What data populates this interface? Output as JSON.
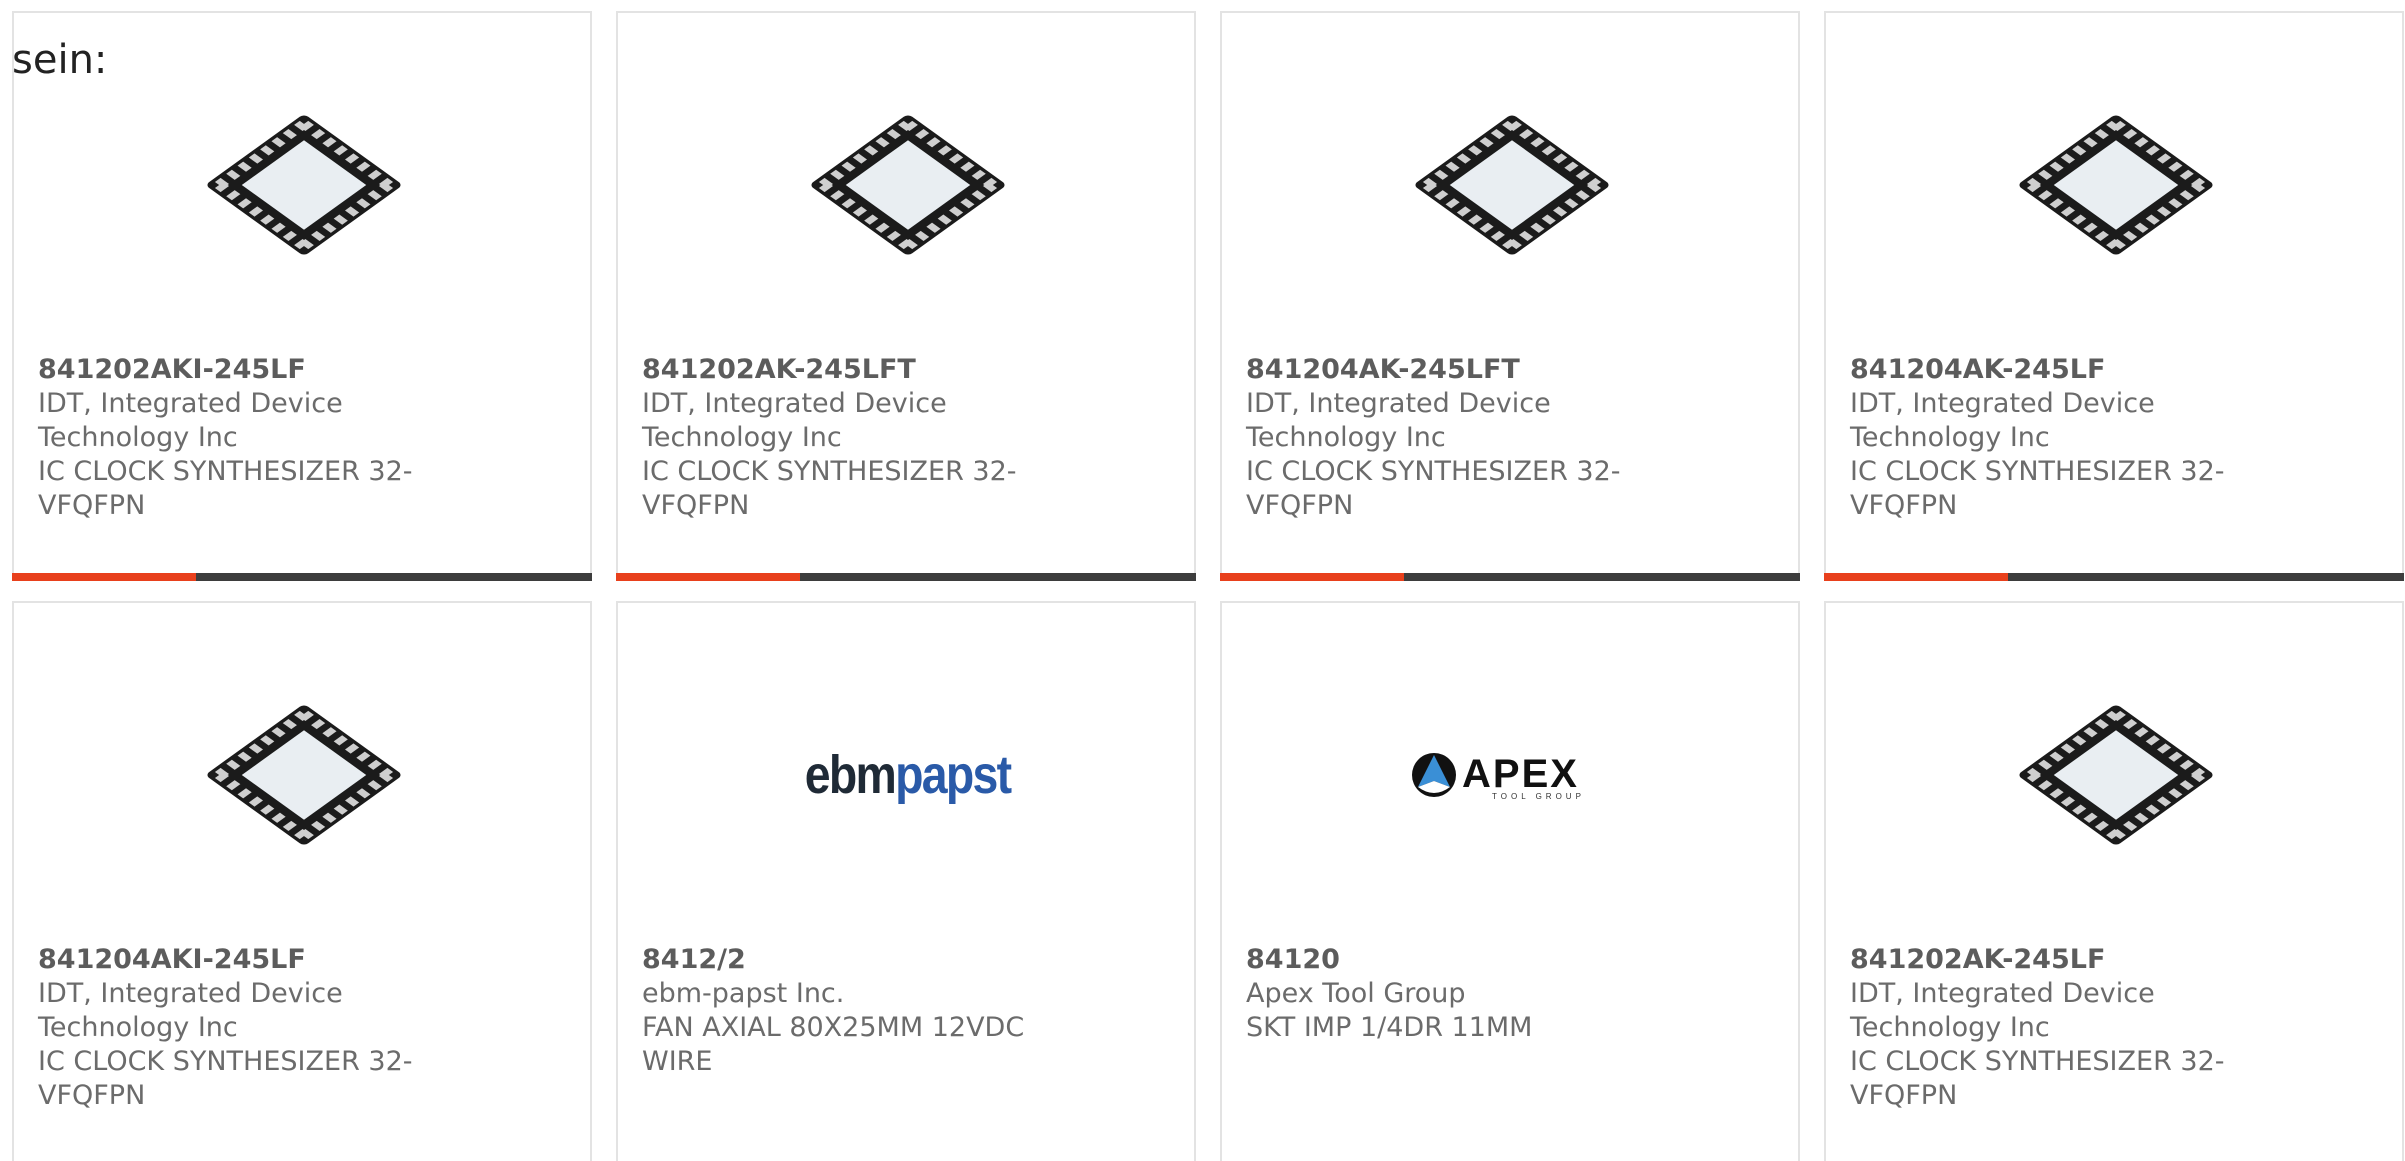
{
  "intro_text": "sein:",
  "accent_color": "#e8401c",
  "bar_color": "#3d3d3d",
  "cards": [
    {
      "part": "841202AKI-245LF",
      "maker": "IDT, Integrated Device Technology Inc",
      "desc": "IC CLOCK SYNTHESIZER 32-VFQFPN",
      "image": "qfn-chip",
      "bar": true
    },
    {
      "part": "841202AK-245LFT",
      "maker": "IDT, Integrated Device Technology Inc",
      "desc": "IC CLOCK SYNTHESIZER 32-VFQFPN",
      "image": "qfn-chip",
      "bar": true
    },
    {
      "part": "841204AK-245LFT",
      "maker": "IDT, Integrated Device Technology Inc",
      "desc": "IC CLOCK SYNTHESIZER 32-VFQFPN",
      "image": "qfn-chip",
      "bar": true
    },
    {
      "part": "841204AK-245LF",
      "maker": "IDT, Integrated Device Technology Inc",
      "desc": "IC CLOCK SYNTHESIZER 32-VFQFPN",
      "image": "qfn-chip",
      "bar": true
    },
    {
      "part": "841204AKI-245LF",
      "maker": "IDT, Integrated Device Technology Inc",
      "desc": "IC CLOCK SYNTHESIZER 32-VFQFPN",
      "image": "qfn-chip",
      "bar": false
    },
    {
      "part": "8412/2",
      "maker": "ebm-papst Inc.",
      "desc": "FAN AXIAL 80X25MM 12VDC WIRE",
      "image": "ebmpapst-logo",
      "logo_parts": [
        "ebm",
        "papst"
      ],
      "bar": false
    },
    {
      "part": "84120",
      "maker": "Apex Tool Group",
      "desc": "SKT IMP 1/4DR 11MM",
      "image": "apex-logo",
      "logo_parts": [
        "APEX",
        "TOOL GROUP"
      ],
      "bar": false
    },
    {
      "part": "841202AK-245LF",
      "maker": "IDT, Integrated Device Technology Inc",
      "desc": "IC CLOCK SYNTHESIZER 32-VFQFPN",
      "image": "qfn-chip",
      "bar": false
    }
  ]
}
